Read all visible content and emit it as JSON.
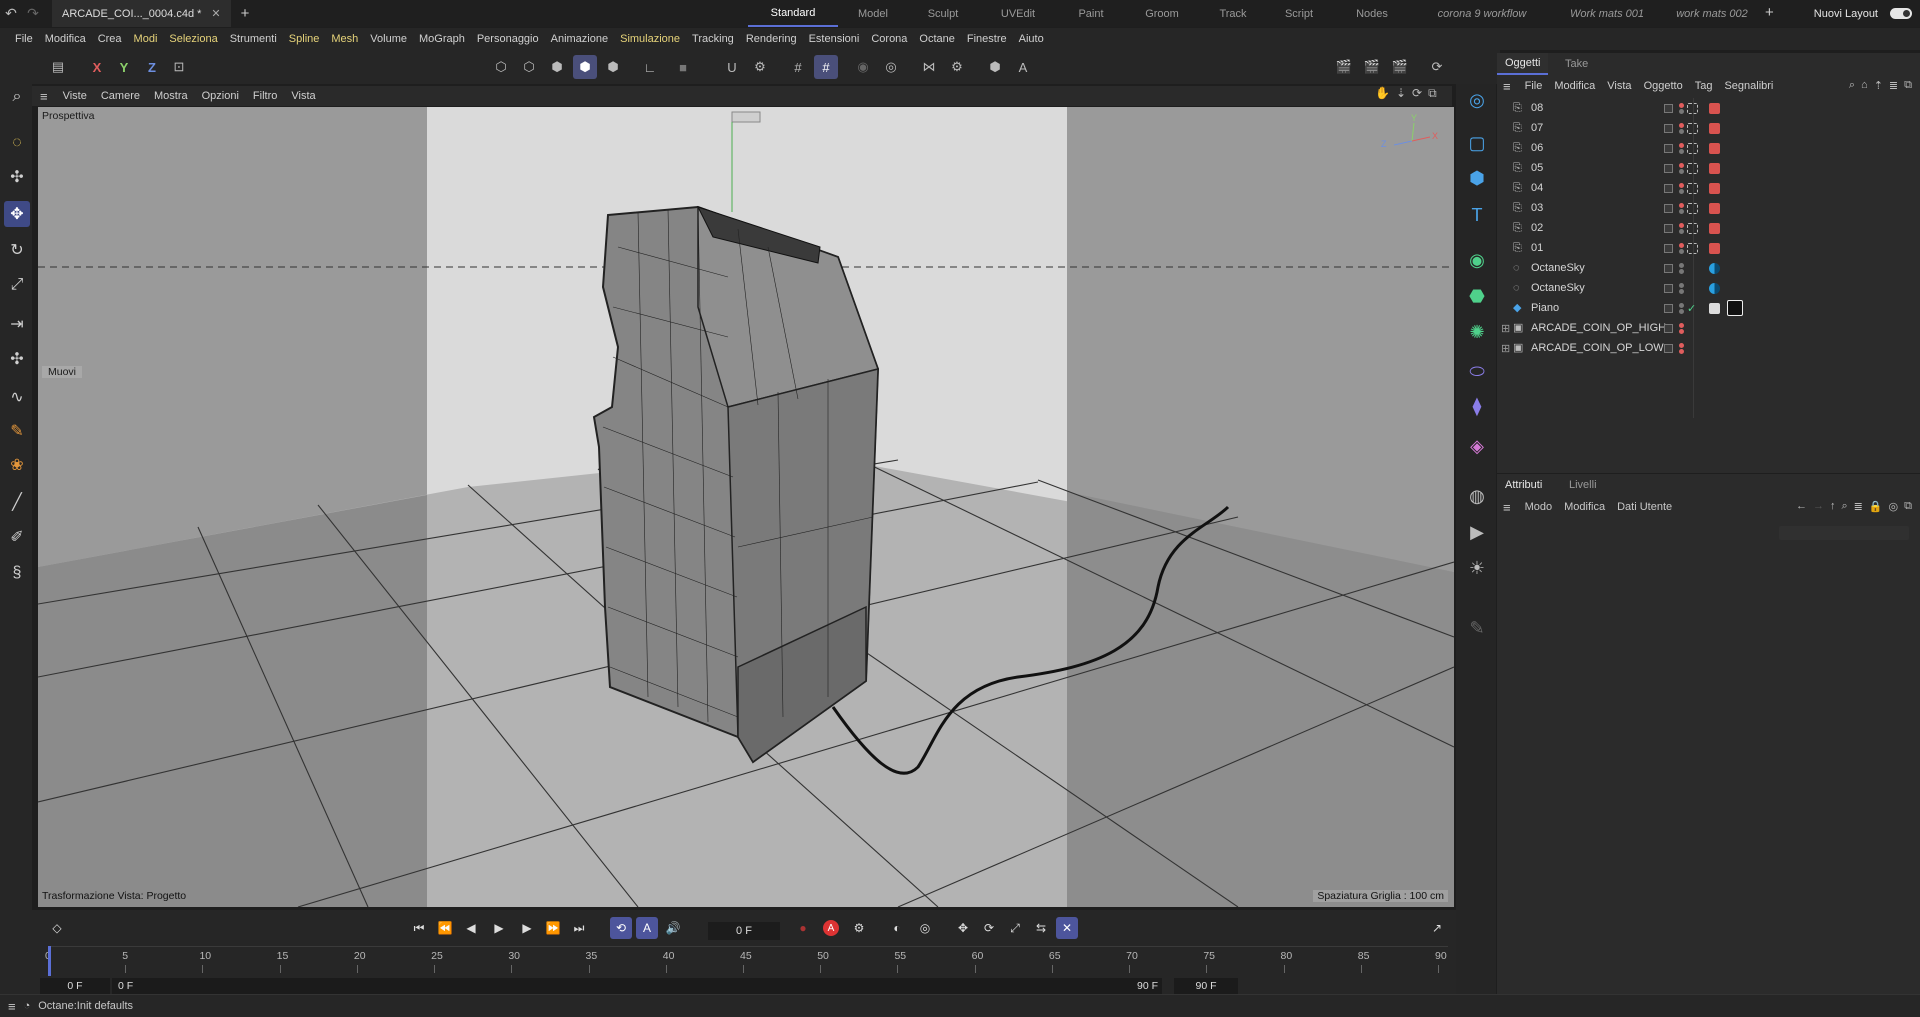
{
  "titlebar": {
    "doc_tab": "ARCADE_COI..._0004.c4d *",
    "layouts": [
      "Standard",
      "Model",
      "Sculpt",
      "UVEdit",
      "Paint",
      "Groom",
      "Track",
      "Script",
      "Nodes",
      "corona 9 workflow",
      "Work mats 001",
      "work mats 002"
    ],
    "active_layout": "Standard",
    "new_layouts": "Nuovi Layout"
  },
  "menubar": {
    "items": [
      {
        "label": "File",
        "highlight": false
      },
      {
        "label": "Modifica",
        "highlight": false
      },
      {
        "label": "Crea",
        "highlight": false
      },
      {
        "label": "Modi",
        "highlight": true
      },
      {
        "label": "Seleziona",
        "highlight": true
      },
      {
        "label": "Strumenti",
        "highlight": false
      },
      {
        "label": "Spline",
        "highlight": true
      },
      {
        "label": "Mesh",
        "highlight": true
      },
      {
        "label": "Volume",
        "highlight": false
      },
      {
        "label": "MoGraph",
        "highlight": false
      },
      {
        "label": "Personaggio",
        "highlight": false
      },
      {
        "label": "Animazione",
        "highlight": false
      },
      {
        "label": "Simulazione",
        "highlight": true
      },
      {
        "label": "Tracking",
        "highlight": false
      },
      {
        "label": "Rendering",
        "highlight": false
      },
      {
        "label": "Estensioni",
        "highlight": false
      },
      {
        "label": "Corona",
        "highlight": false
      },
      {
        "label": "Octane",
        "highlight": false
      },
      {
        "label": "Finestre",
        "highlight": false
      },
      {
        "label": "Aiuto",
        "highlight": false
      }
    ]
  },
  "toolbar": {
    "axis_x": "X",
    "axis_y": "Y",
    "axis_z": "Z"
  },
  "viewport": {
    "menu": [
      "Viste",
      "Camere",
      "Mostra",
      "Opzioni",
      "Filtro",
      "Vista"
    ],
    "camera_label": "Prospettiva",
    "move_label": "Muovi",
    "transform_label": "Trasformazione Vista: Progetto",
    "grid_label": "Spaziatura Griglia : 100 cm",
    "axis_x": "X",
    "axis_y": "Y",
    "axis_z": "Z"
  },
  "objects_panel": {
    "tabs": [
      "Oggetti",
      "Take"
    ],
    "menu": [
      "File",
      "Modifica",
      "Vista",
      "Oggetto",
      "Tag",
      "Segnalibri"
    ],
    "rows": [
      {
        "name": "08",
        "type": "camera"
      },
      {
        "name": "07",
        "type": "camera"
      },
      {
        "name": "06",
        "type": "camera"
      },
      {
        "name": "05",
        "type": "camera"
      },
      {
        "name": "04",
        "type": "camera"
      },
      {
        "name": "03",
        "type": "camera"
      },
      {
        "name": "02",
        "type": "camera"
      },
      {
        "name": "01",
        "type": "camera"
      },
      {
        "name": "OctaneSky",
        "type": "sky"
      },
      {
        "name": "OctaneSky",
        "type": "sky"
      },
      {
        "name": "Piano",
        "type": "plane"
      },
      {
        "name": "ARCADE_COIN_OP_HIGH",
        "type": "null"
      },
      {
        "name": "ARCADE_COIN_OP_LOW",
        "type": "null"
      }
    ]
  },
  "attributes_panel": {
    "tabs": [
      "Attributi",
      "Livelli"
    ],
    "menu": [
      "Modo",
      "Modifica",
      "Dati Utente"
    ]
  },
  "timeline": {
    "current_frame": "0 F",
    "ticks": [
      "0",
      "5",
      "10",
      "15",
      "20",
      "25",
      "30",
      "35",
      "40",
      "45",
      "50",
      "55",
      "60",
      "65",
      "70",
      "75",
      "80",
      "85",
      "90"
    ],
    "range_start": "0 F",
    "range_start2": "0 F",
    "range_end": "90 F",
    "range_end2": "90 F"
  },
  "status": {
    "text": "Octane:Init defaults"
  }
}
